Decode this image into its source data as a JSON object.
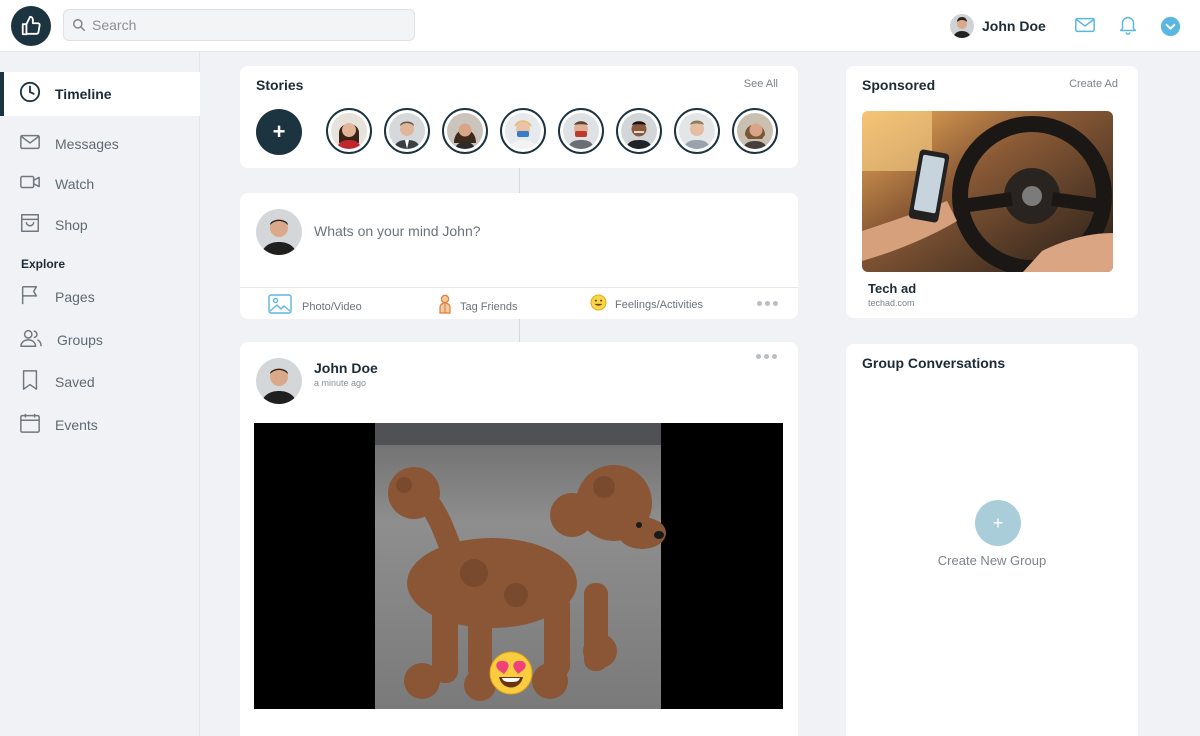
{
  "search": {
    "placeholder": "Search"
  },
  "header": {
    "user_name": "John Doe"
  },
  "sidebar": {
    "items": [
      {
        "label": "Timeline",
        "icon": "clock-icon"
      },
      {
        "label": "Messages",
        "icon": "mail-icon"
      },
      {
        "label": "Watch",
        "icon": "video-icon"
      },
      {
        "label": "Shop",
        "icon": "shopping-bag-icon"
      },
      {
        "label": "Pages",
        "icon": "flag-icon"
      },
      {
        "label": "Groups",
        "icon": "users-icon"
      },
      {
        "label": "Saved",
        "icon": "bookmark-icon"
      },
      {
        "label": "Events",
        "icon": "calendar-icon"
      }
    ],
    "section_label": "Explore"
  },
  "stories": {
    "title": "Stories",
    "see_all": "See All",
    "add_label": "+"
  },
  "composer": {
    "placeholder": "Whats on your mind John?",
    "actions": [
      {
        "label": "Photo/Video",
        "icon": "photo-icon"
      },
      {
        "label": "Tag Friends",
        "icon": "tag-friends-icon"
      },
      {
        "label": "Feelings/Activities",
        "icon": "smiley-icon"
      }
    ]
  },
  "post": {
    "author": "John Doe",
    "time": "a minute ago",
    "image": "brown poodle walking on pavement with heart-eyes emoji"
  },
  "sponsored": {
    "title": "Sponsored",
    "create_ad": "Create Ad",
    "ad_name": "Tech ad",
    "ad_url": "techad.com",
    "ad_image": "hands holding phone at car steering wheel"
  },
  "groups": {
    "title": "Group Conversations",
    "create_icon": "+",
    "create_label": "Create New Group"
  },
  "colors": {
    "primary": "#1c3340",
    "accent": "#5ab7e2",
    "group_button": "#a9cdd9"
  }
}
